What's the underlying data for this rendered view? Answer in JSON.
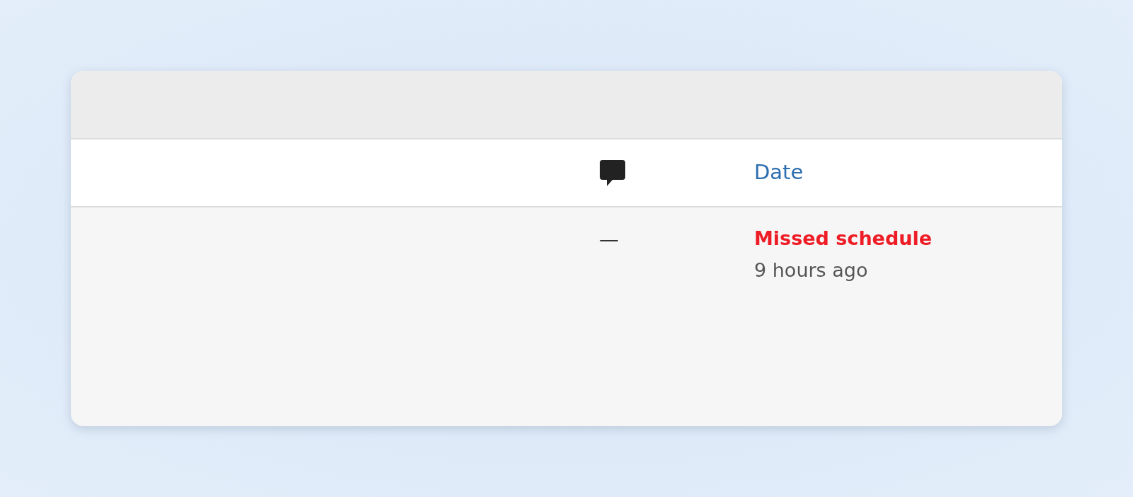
{
  "table": {
    "columns": [
      {
        "kind": "comments-icon"
      },
      {
        "kind": "link",
        "label": "Date"
      }
    ],
    "rows": [
      {
        "comments": "—",
        "date_status": "Missed schedule",
        "date_time": "9 hours ago"
      }
    ]
  }
}
